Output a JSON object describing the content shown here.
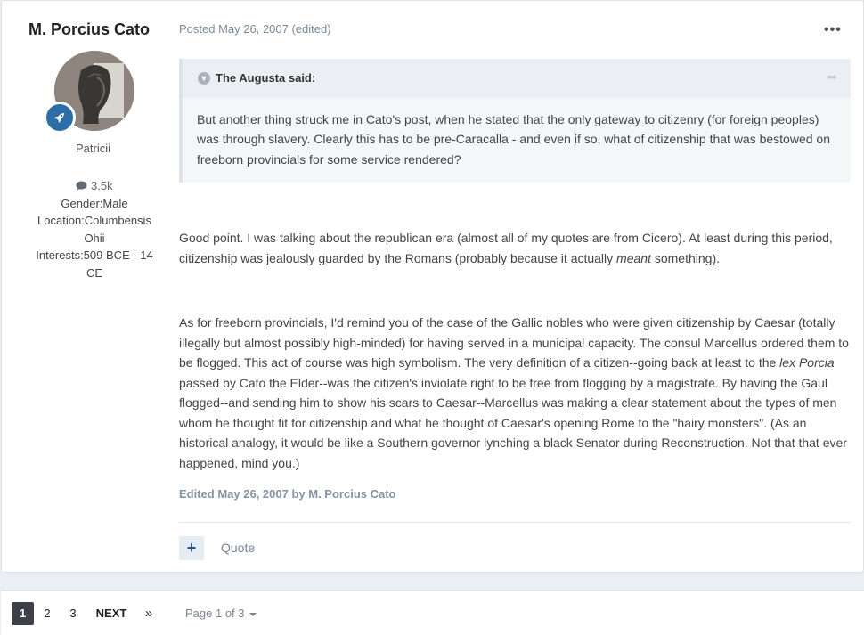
{
  "author": {
    "name": "M. Porcius Cato",
    "group": "Patricii",
    "posts_count": "3.5k",
    "gender_label": "Gender:",
    "gender": "Male",
    "location_label": "Location:",
    "location": "Columbensis Ohii",
    "interests_label": "Interests:",
    "interests": "509 BCE - 14 CE"
  },
  "post": {
    "posted": "Posted May 26, 2007 (edited)",
    "more_icon": "•••",
    "quote": {
      "cite": "The Augusta said:",
      "text": "But another thing struck me in Cato's post, when he stated that the only gateway to citizenry (for foreign peoples) was through slavery. Clearly this has to be pre-Caracalla - and even if so, what of citizenship that was bestowed on freeborn provincials for some service rendered?"
    },
    "para1": {
      "a": "Good point. I was talking about the republican era (almost all of my quotes are from Cicero). At least during this period, citizenship was jealously guarded by the Romans (probably because it actually ",
      "em": "meant",
      "b": " something)."
    },
    "para2": {
      "a": "As for freeborn provincials, I'd remind you of the case of the Gallic nobles who were given citizenship by Caesar (totally illegally but almost possibly high-minded) for having served in a municipal capacity. The consul Marcellus ordered them to be flogged. This act of course was high symbolism. The very definition of a citizen--going back at least to the ",
      "em": "lex Porcia",
      "b": " passed by Cato the Elder--was the citizen's inviolate right to be free from flogging by a magistrate. By having the Gaul flogged--and sending him to show his scars to Caesar--Marcellus was making a clear statement about the types of men whom he thought fit for citizenship and what he thought of Caesar's opening Rome to the \"hairy monsters\". (As an historical analogy, it would be like a Southern governor lynching a black Senator during Reconstruction. Not that that ever happened, mind you.)"
    },
    "edited": "Edited May 26, 2007 by M. Porcius Cato",
    "plus_label": "+",
    "quote_button": "Quote"
  },
  "pagination": {
    "pages": [
      "1",
      "2",
      "3"
    ],
    "next": "NEXT",
    "last": "»",
    "page_of": "Page 1 of 3"
  },
  "colors": {
    "accent": "#2a6fa8",
    "active_page": "#3d4147"
  }
}
